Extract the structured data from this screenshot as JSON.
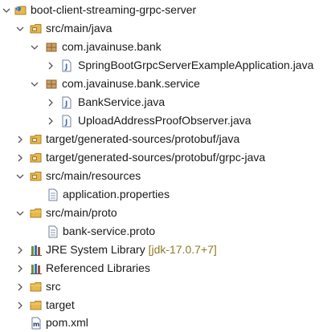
{
  "tree": {
    "items": [
      {
        "label": "boot-client-streaming-grpc-server",
        "icon": "java-project-icon",
        "expanded": true
      },
      {
        "label": "src/main/java",
        "icon": "source-folder-icon",
        "expanded": true
      },
      {
        "label": "com.javainuse.bank",
        "icon": "package-icon",
        "expanded": true
      },
      {
        "label": "SpringBootGrpcServerExampleApplication.java",
        "icon": "java-file-icon",
        "expanded": false
      },
      {
        "label": "com.javainuse.bank.service",
        "icon": "package-icon",
        "expanded": true
      },
      {
        "label": "BankService.java",
        "icon": "java-file-icon",
        "expanded": false
      },
      {
        "label": "UploadAddressProofObserver.java",
        "icon": "java-file-icon",
        "expanded": false
      },
      {
        "label": "target/generated-sources/protobuf/java",
        "icon": "source-folder-icon",
        "expanded": false
      },
      {
        "label": "target/generated-sources/protobuf/grpc-java",
        "icon": "source-folder-icon",
        "expanded": false
      },
      {
        "label": "src/main/resources",
        "icon": "source-folder-icon",
        "expanded": true
      },
      {
        "label": "application.properties",
        "icon": "text-file-icon"
      },
      {
        "label": "src/main/proto",
        "icon": "folder-icon",
        "expanded": true
      },
      {
        "label": "bank-service.proto",
        "icon": "text-file-icon"
      },
      {
        "label": "JRE System Library",
        "decoration": "[jdk-17.0.7+7]",
        "icon": "library-icon",
        "expanded": false
      },
      {
        "label": "Referenced Libraries",
        "icon": "library-icon",
        "expanded": false
      },
      {
        "label": "src",
        "icon": "folder-icon",
        "expanded": false
      },
      {
        "label": "target",
        "icon": "folder-icon",
        "expanded": false
      },
      {
        "label": "pom.xml",
        "icon": "maven-file-icon"
      }
    ]
  },
  "colors": {
    "decoration": "#8c7b2a",
    "folder": "#e8b84a",
    "package": "#a07b3a",
    "java_file": "#3b6fb6"
  }
}
